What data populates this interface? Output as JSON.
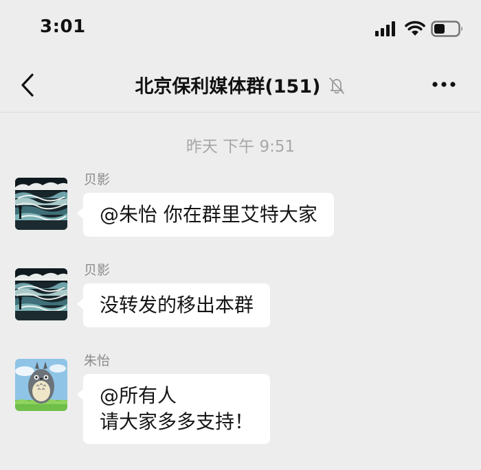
{
  "status_bar": {
    "time": "3:01",
    "icons": [
      "cellular-signal-icon",
      "wifi-icon",
      "battery-icon"
    ]
  },
  "nav_bar": {
    "title": "北京保利媒体群(151)",
    "icons": [
      "back-chevron-icon",
      "mute-bell-icon",
      "more-dots-icon"
    ]
  },
  "chat": {
    "timestamp": "昨天 下午 9:51",
    "messages": [
      {
        "sender": "贝影",
        "text": "@朱怡 你在群里艾特大家"
      },
      {
        "sender": "贝影",
        "text": "没转发的移出本群"
      },
      {
        "sender": "朱怡",
        "text": "@所有人\n请大家多多支持！"
      }
    ]
  },
  "colors": {
    "background": "#ededed",
    "bubble": "#ffffff",
    "sender_name": "#8a8a8a",
    "timestamp": "#a7a7a7"
  }
}
